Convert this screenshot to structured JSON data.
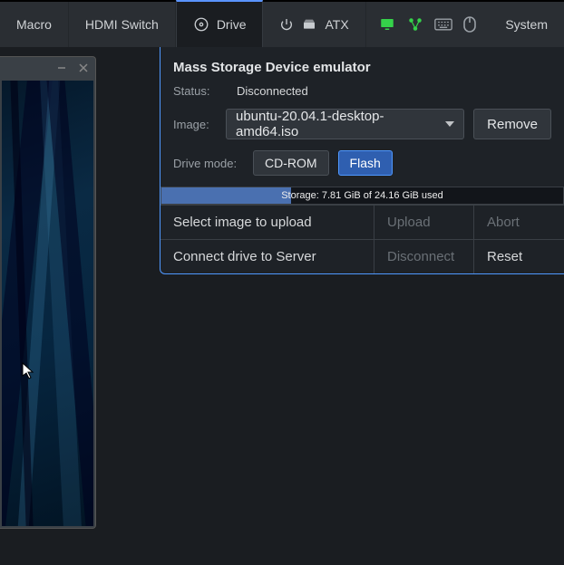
{
  "topbar": {
    "macro": "Macro",
    "hdmi": "HDMI Switch",
    "drive": "Drive",
    "atx": "ATX",
    "system": "System"
  },
  "panel": {
    "title": "Mass Storage Device emulator",
    "status_label": "Status:",
    "status_value": "Disconnected",
    "image_label": "Image:",
    "image_selected": "ubuntu-20.04.1-desktop-amd64.iso",
    "remove": "Remove",
    "mode_label": "Drive mode:",
    "mode_cdrom": "CD-ROM",
    "mode_flash": "Flash",
    "storage_text": "Storage: 7.81 GiB of 24.16 GiB used",
    "row1_label": "Select image to upload",
    "row1_upload": "Upload",
    "row1_abort": "Abort",
    "row2_label": "Connect drive to Server",
    "row2_disconnect": "Disconnect",
    "row2_reset": "Reset"
  }
}
